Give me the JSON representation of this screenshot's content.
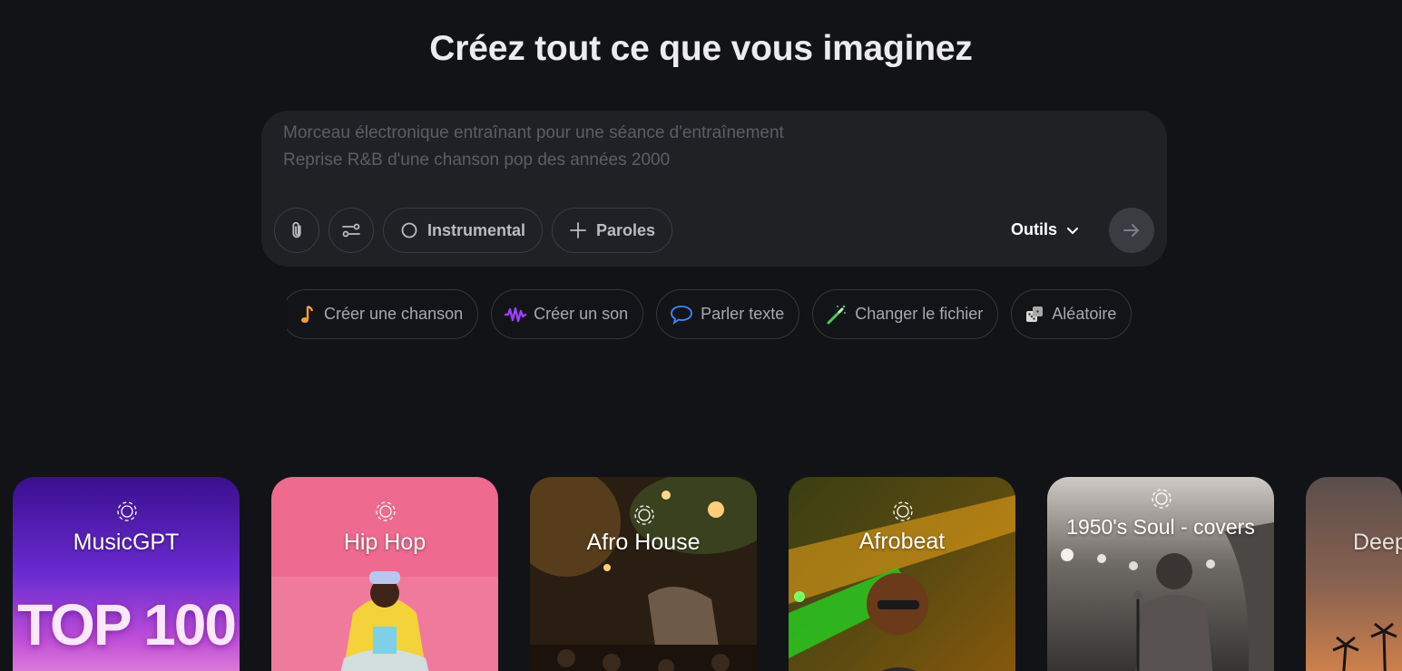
{
  "headline": "Créez tout ce que vous imaginez",
  "prompt": {
    "placeholder_lines": [
      "Morceau électronique entraînant pour une séance d'entraînement",
      "Reprise R&B d'une chanson pop des années 2000"
    ],
    "attach_icon": "paperclip-icon",
    "settings_icon": "sliders-icon",
    "instrumental_label": "Instrumental",
    "lyrics_label": "Paroles",
    "tools_label": "Outils",
    "send_icon": "arrow-right-icon"
  },
  "suggestions": [
    {
      "label": "Créer une chanson",
      "icon": "music-note-icon",
      "color": "#f0a030"
    },
    {
      "label": "Créer un son",
      "icon": "waveform-icon",
      "color": "#9b3fff"
    },
    {
      "label": "Parler texte",
      "icon": "speech-bubble-icon",
      "color": "#2f8fff"
    },
    {
      "label": "Changer le fichier",
      "icon": "magic-wand-icon",
      "color": "#3fcf5f"
    },
    {
      "label": "Aléatoire",
      "icon": "dice-icon",
      "color": "#c8c8c8"
    }
  ],
  "cards": [
    {
      "title": "MusicGPT",
      "subtitle": "TOP 100"
    },
    {
      "title": "Hip Hop"
    },
    {
      "title": "Afro House"
    },
    {
      "title": "Afrobeat"
    },
    {
      "title": "1950's Soul - covers"
    },
    {
      "title": "Deep"
    }
  ]
}
